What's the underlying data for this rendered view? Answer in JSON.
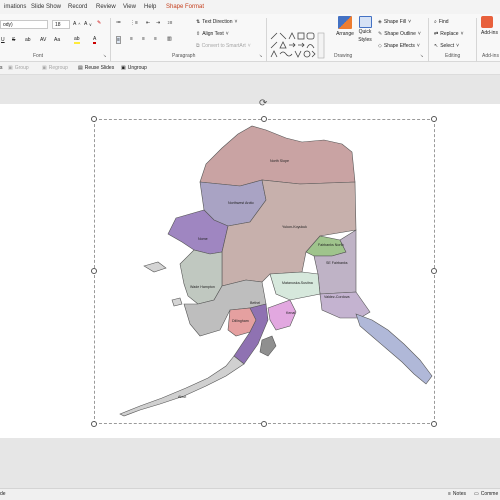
{
  "tabs": [
    "imations",
    "Slide Show",
    "Record",
    "Review",
    "View",
    "Help",
    "Shape Format"
  ],
  "font": {
    "name": "ody)",
    "size": "18"
  },
  "paragraph": {
    "text_direction": "Text Direction",
    "align_text": "Align Text",
    "smartart": "Convert to SmartArt",
    "group_label": "Paragraph"
  },
  "font_group_label": "Font",
  "drawing": {
    "arrange": "Arrange",
    "quick_styles_1": "Quick",
    "quick_styles_2": "Styles",
    "shape_fill": "Shape Fill",
    "shape_outline": "Shape Outline",
    "shape_effects": "Shape Effects",
    "group_label": "Drawing"
  },
  "editing": {
    "find": "Find",
    "replace": "Replace",
    "select": "Select",
    "group_label": "Editing"
  },
  "addins": {
    "label": "Add-ins",
    "group_label": "Add-ins"
  },
  "quickbar": {
    "item1": "s",
    "group": "Group",
    "regroup": "Regroup",
    "reuse_slides": "Reuse Slides",
    "ungroup": "Ungroup"
  },
  "map": {
    "regions": [
      "North Slope",
      "Northwest Arctic",
      "Nome",
      "Yukon-Koyukuk",
      "Fairbanks North",
      "SE Fairbanks",
      "Wade Hampton",
      "Matanuska-Susitna",
      "Valdez-Cordova",
      "Bethel",
      "Dillingham",
      "Kenai",
      "Aleut"
    ]
  },
  "status": {
    "left": "de",
    "notes": "Notes",
    "comments": "Comme"
  }
}
